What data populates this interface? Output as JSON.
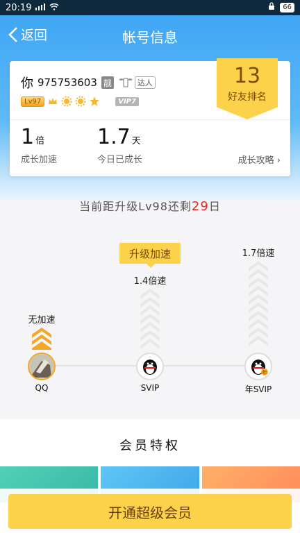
{
  "status_bar": {
    "time": "20:19",
    "battery": "66"
  },
  "nav": {
    "back_label": "返回",
    "title": "帐号信息"
  },
  "profile": {
    "name": "你",
    "uid": "975753603",
    "liang": "靓",
    "daren": "达人",
    "level_label": "Lv97",
    "vip_label": "VIP7"
  },
  "rank": {
    "number": "13",
    "label": "好友排名"
  },
  "stats": [
    {
      "value": "1",
      "unit": "倍",
      "label": "成长加速"
    },
    {
      "value": "1.7",
      "unit": "天",
      "label": "今日已成长"
    }
  ],
  "growth_guide": "成长攻略",
  "upgrade": {
    "prefix": "当前距升级Lv98还剩",
    "days": "29",
    "suffix": "日"
  },
  "speed": {
    "upgrade_tag": "升级加速",
    "nodes": [
      {
        "label": "QQ",
        "speed": "无加速"
      },
      {
        "label": "SVIP",
        "speed": "1.4倍速"
      },
      {
        "label": "年SVIP",
        "speed": "1.7倍速"
      }
    ]
  },
  "privileges": {
    "title": "会员特权"
  },
  "cta": {
    "label": "开通超级会员"
  },
  "colors": {
    "accent": "#fcd24a",
    "header_blue": "#3aa3f4",
    "days_red": "#e52323"
  }
}
